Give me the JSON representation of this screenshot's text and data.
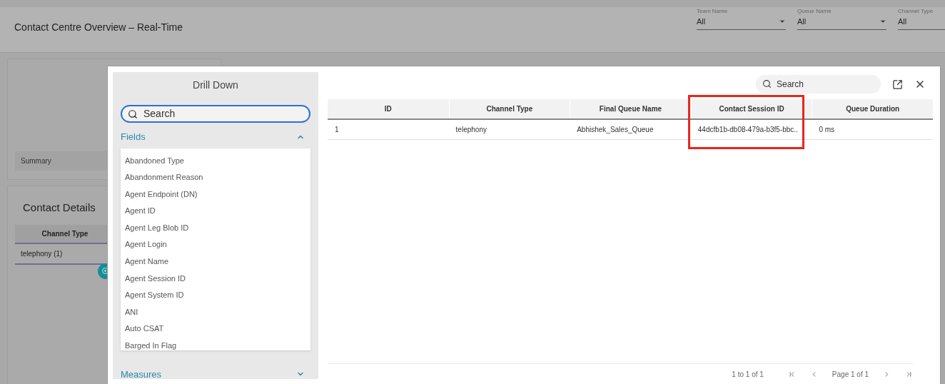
{
  "header": {
    "title": "Contact Centre Overview – Real-Time",
    "filters": [
      {
        "label": "Team Name",
        "value": "All"
      },
      {
        "label": "Queue Name",
        "value": "All"
      },
      {
        "label": "Channel Type",
        "value": "All"
      }
    ]
  },
  "background": {
    "summary_tab": "Summary",
    "section_title": "Contact Details",
    "table_header": "Channel Type",
    "table_row": "telephony (1)"
  },
  "drill_down": {
    "title": "Drill Down",
    "search": {
      "value": "Search"
    },
    "sections": [
      {
        "label": "Fields",
        "expanded": true,
        "items": [
          "Abandoned Type",
          "Abandonment Reason",
          "Agent Endpoint (DN)",
          "Agent ID",
          "Agent Leg Blob ID",
          "Agent Login",
          "Agent Name",
          "Agent Session ID",
          "Agent System ID",
          "ANI",
          "Auto CSAT",
          "Barged In Flag"
        ]
      },
      {
        "label": "Measures",
        "expanded": false
      }
    ]
  },
  "results": {
    "search": {
      "placeholder": "Search"
    },
    "columns": [
      {
        "label": "ID",
        "highlighted": false
      },
      {
        "label": "Channel Type",
        "highlighted": false
      },
      {
        "label": "Final Queue Name",
        "highlighted": false
      },
      {
        "label": "Contact Session ID",
        "highlighted": true
      },
      {
        "label": "Queue Duration",
        "highlighted": false
      }
    ],
    "rows": [
      [
        "1",
        "telephony",
        "Abhishek_Sales_Queue",
        "44dcfb1b-db08-479a-b3f5-bbc..",
        "0 ms"
      ]
    ],
    "row_count": "1 to 1 of 1",
    "page": "Page 1 of 1"
  }
}
